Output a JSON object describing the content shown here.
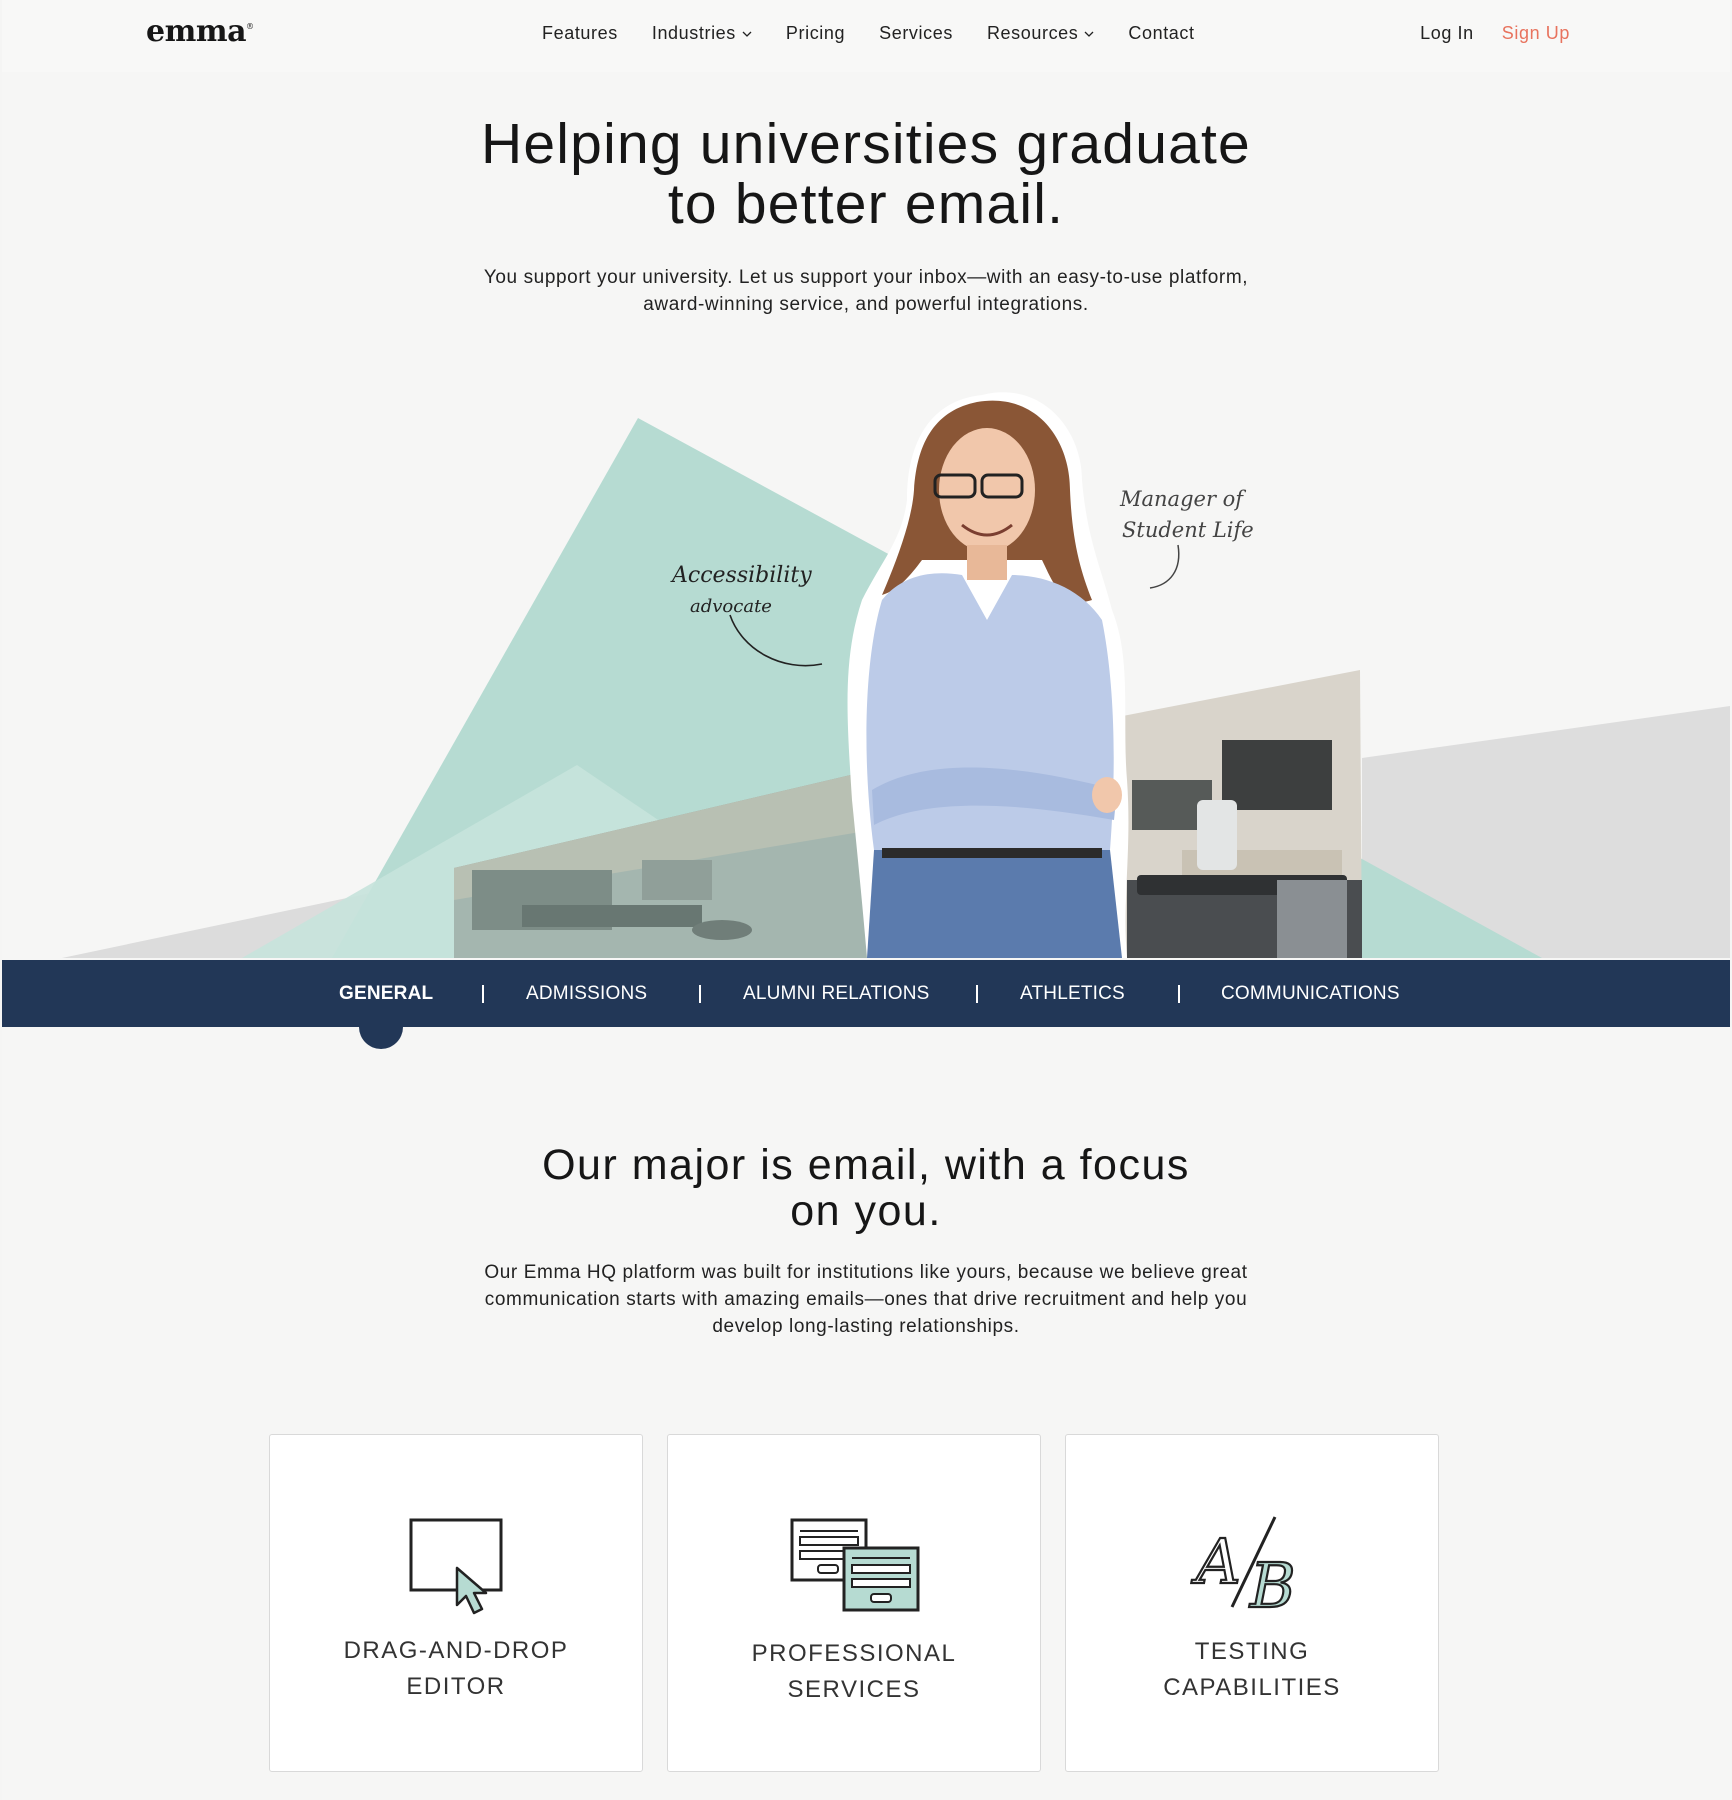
{
  "header": {
    "logo": "emma",
    "logo_mark": "®",
    "nav": [
      {
        "label": "Features",
        "has_dropdown": false
      },
      {
        "label": "Industries",
        "has_dropdown": true
      },
      {
        "label": "Pricing",
        "has_dropdown": false
      },
      {
        "label": "Services",
        "has_dropdown": false
      },
      {
        "label": "Resources",
        "has_dropdown": true
      },
      {
        "label": "Contact",
        "has_dropdown": false
      }
    ],
    "login": "Log In",
    "signup": "Sign Up"
  },
  "hero": {
    "title_line1": "Helping universities graduate",
    "title_line2": "to better email.",
    "subtitle_line1": "You support your university. Let us support your inbox—with an easy-to-use platform,",
    "subtitle_line2": "award-winning service, and powerful integrations.",
    "annotation_left_line1": "Accessibility",
    "annotation_left_line2": "advocate",
    "annotation_right_line1": "Manager of",
    "annotation_right_line2": "Student Life"
  },
  "tabs": [
    {
      "label": "GENERAL",
      "active": true
    },
    {
      "label": "ADMISSIONS",
      "active": false
    },
    {
      "label": "ALUMNI RELATIONS",
      "active": false
    },
    {
      "label": "ATHLETICS",
      "active": false
    },
    {
      "label": "COMMUNICATIONS",
      "active": false
    }
  ],
  "section": {
    "title_line1": "Our major is email, with a focus",
    "title_line2": "on you.",
    "body_line1": "Our Emma HQ platform was built for institutions like yours, because we believe great",
    "body_line2": "communication starts with amazing emails—ones that drive recruitment and help you",
    "body_line3": "develop long-lasting relationships."
  },
  "cards": [
    {
      "icon": "drag-drop-cursor-icon",
      "line1": "DRAG-AND-DROP",
      "line2": "EDITOR"
    },
    {
      "icon": "stacked-cards-icon",
      "line1": "PROFESSIONAL",
      "line2": "SERVICES"
    },
    {
      "icon": "ab-testing-icon",
      "line1": "TESTING",
      "line2": "CAPABILITIES"
    }
  ],
  "colors": {
    "navy": "#223757",
    "mint": "#b6dbd2",
    "accent_coral": "#e8735e",
    "page_bg": "#f6f6f5"
  }
}
